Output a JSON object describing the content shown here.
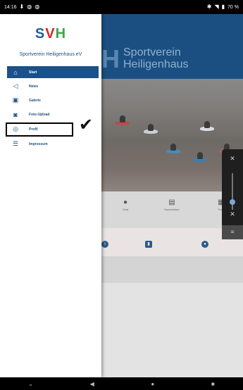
{
  "status_bar": {
    "time": "14:16",
    "left_icons": [
      "download-icon",
      "notification-icon",
      "notification-icon"
    ],
    "battery": "70 %"
  },
  "drawer": {
    "logo_letters": [
      "S",
      "V",
      "H"
    ],
    "club_name": "Sportverein Heiligenhaus eV",
    "items": [
      {
        "label": "Start",
        "icon": "home-tag-icon",
        "active": true
      },
      {
        "label": "News",
        "icon": "send-icon",
        "active": false
      },
      {
        "label": "Galerie",
        "icon": "gallery-icon",
        "active": false
      },
      {
        "label": "Foto-Upload",
        "icon": "camera-icon",
        "active": false
      },
      {
        "label": "Profil",
        "icon": "profile-icon",
        "active": false
      },
      {
        "label": "Impressum",
        "icon": "list-icon",
        "active": false
      }
    ],
    "active_bg": "#1b5088"
  },
  "background_app": {
    "logo_letter": "H",
    "title_line1": "Sportverein",
    "title_line2": "Heiligenhaus",
    "header_color": "#1b4f82",
    "shortcuts": [
      {
        "label": "Chat",
        "icon": "chat-icon"
      },
      {
        "label": "Nachrichten",
        "icon": "message-icon"
      },
      {
        "label": "Term",
        "icon": "calendar-icon"
      }
    ]
  },
  "annotation": {
    "checkmark_glyph": "✔"
  },
  "nav_bar": {
    "buttons": [
      "hide-keyboard-icon",
      "back-icon",
      "home-icon",
      "recents-icon"
    ]
  }
}
